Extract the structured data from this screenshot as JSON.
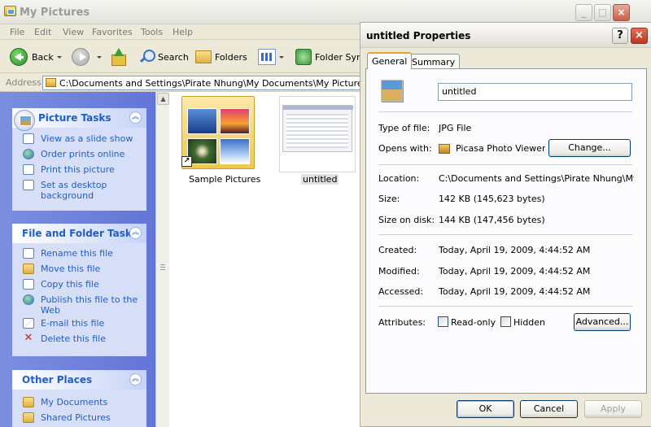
{
  "window": {
    "title": "My Pictures",
    "menu": [
      "File",
      "Edit",
      "View",
      "Favorites",
      "Tools",
      "Help"
    ],
    "toolbar": {
      "back": "Back",
      "search": "Search",
      "folders": "Folders",
      "folder_sync": "Folder Sync"
    },
    "address_label": "Address",
    "address_value": "C:\\Documents and Settings\\Pirate Nhung\\My Documents\\My Pictures"
  },
  "tasks": {
    "picture_tasks": {
      "title": "Picture Tasks",
      "items": [
        "View as a slide show",
        "Order prints online",
        "Print this picture",
        "Set as desktop background"
      ]
    },
    "file_folder_tasks": {
      "title": "File and Folder Tasks",
      "items": [
        "Rename this file",
        "Move this file",
        "Copy this file",
        "Publish this file to the Web",
        "E-mail this file",
        "Delete this file"
      ]
    },
    "other_places": {
      "title": "Other Places",
      "items": [
        "My Documents",
        "Shared Pictures"
      ]
    }
  },
  "files": [
    {
      "name": "Sample Pictures"
    },
    {
      "name": "untitled",
      "selected": true
    }
  ],
  "dialog": {
    "title": "untitled Properties",
    "tabs": [
      "General",
      "Summary"
    ],
    "file_name": "untitled",
    "type_label": "Type of file:",
    "type_value": "JPG File",
    "opens_label": "Opens with:",
    "opens_value": "Picasa Photo Viewer",
    "change_button": "Change...",
    "location_label": "Location:",
    "location_value": "C:\\Documents and Settings\\Pirate Nhung\\My Docu",
    "size_label": "Size:",
    "size_value": "142 KB (145,623 bytes)",
    "size_disk_label": "Size on disk:",
    "size_disk_value": "144 KB (147,456 bytes)",
    "created_label": "Created:",
    "created_value": "Today, April 19, 2009, 4:44:52 AM",
    "modified_label": "Modified:",
    "modified_value": "Today, April 19, 2009, 4:44:52 AM",
    "accessed_label": "Accessed:",
    "accessed_value": "Today, April 19, 2009, 4:44:52 AM",
    "attributes_label": "Attributes:",
    "readonly_label": "Read-only",
    "readonly_checked": false,
    "hidden_label": "Hidden",
    "hidden_checked": false,
    "advanced_button": "Advanced...",
    "ok_button": "OK",
    "cancel_button": "Cancel",
    "apply_button": "Apply"
  }
}
